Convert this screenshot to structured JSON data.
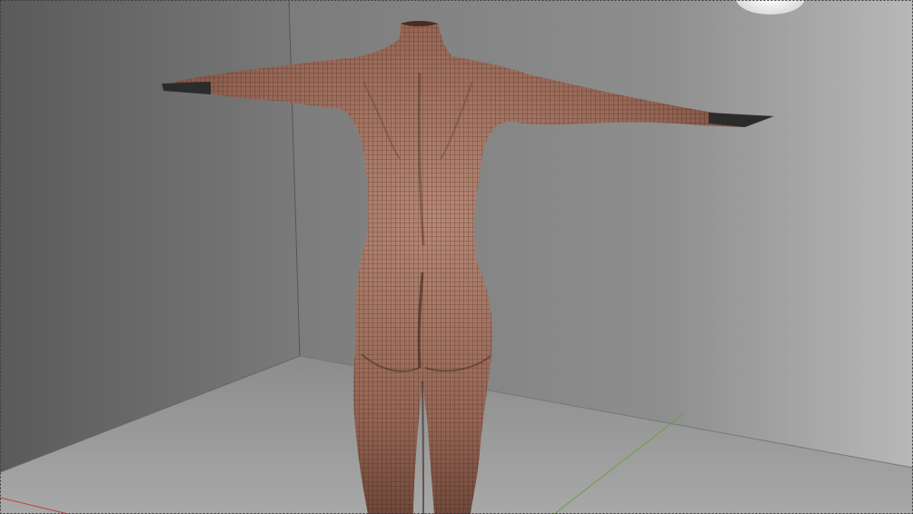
{
  "viewport": {
    "view": "3d-viewport",
    "shading": "wireframe-on-shaded",
    "object": "human-body-mesh",
    "pose": "t-pose",
    "camera": "rear-three-quarter"
  },
  "colors": {
    "back_wall_light": "#9a9a9a",
    "back_wall_dark": "#6f6f6f",
    "left_wall_light": "#8a8a8a",
    "left_wall_dark": "#5c5c5c",
    "floor_light": "#a6a6a6",
    "floor_dark": "#7d7d7d",
    "mesh_skin": "#9c6e5c",
    "mesh_skin_dark": "#6a4436",
    "wire": "#2a1a14",
    "axis_x": "#c04040",
    "axis_y": "#6aa040",
    "light_orb": "#f2f2f2"
  },
  "icons": [
    "light-orb-icon",
    "axis-x-icon",
    "axis-y-icon"
  ]
}
